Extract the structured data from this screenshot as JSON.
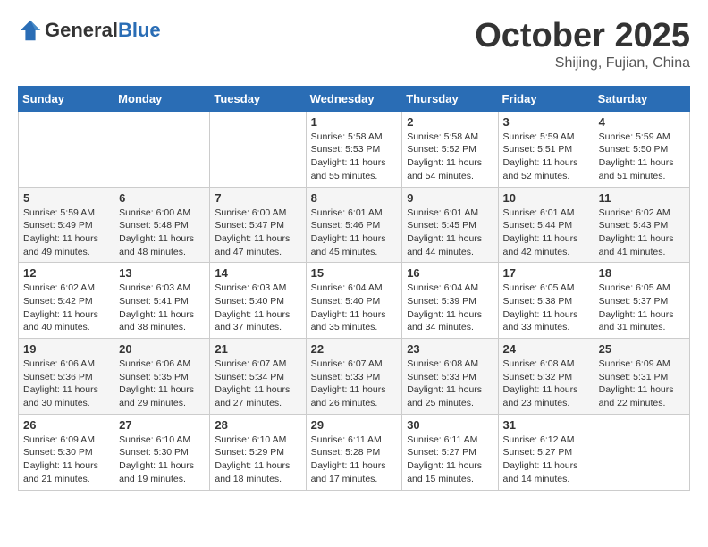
{
  "header": {
    "logo_general": "General",
    "logo_blue": "Blue",
    "month": "October 2025",
    "location": "Shijing, Fujian, China"
  },
  "weekdays": [
    "Sunday",
    "Monday",
    "Tuesday",
    "Wednesday",
    "Thursday",
    "Friday",
    "Saturday"
  ],
  "weeks": [
    [
      {
        "day": "",
        "info": ""
      },
      {
        "day": "",
        "info": ""
      },
      {
        "day": "",
        "info": ""
      },
      {
        "day": "1",
        "info": "Sunrise: 5:58 AM\nSunset: 5:53 PM\nDaylight: 11 hours and 55 minutes."
      },
      {
        "day": "2",
        "info": "Sunrise: 5:58 AM\nSunset: 5:52 PM\nDaylight: 11 hours and 54 minutes."
      },
      {
        "day": "3",
        "info": "Sunrise: 5:59 AM\nSunset: 5:51 PM\nDaylight: 11 hours and 52 minutes."
      },
      {
        "day": "4",
        "info": "Sunrise: 5:59 AM\nSunset: 5:50 PM\nDaylight: 11 hours and 51 minutes."
      }
    ],
    [
      {
        "day": "5",
        "info": "Sunrise: 5:59 AM\nSunset: 5:49 PM\nDaylight: 11 hours and 49 minutes."
      },
      {
        "day": "6",
        "info": "Sunrise: 6:00 AM\nSunset: 5:48 PM\nDaylight: 11 hours and 48 minutes."
      },
      {
        "day": "7",
        "info": "Sunrise: 6:00 AM\nSunset: 5:47 PM\nDaylight: 11 hours and 47 minutes."
      },
      {
        "day": "8",
        "info": "Sunrise: 6:01 AM\nSunset: 5:46 PM\nDaylight: 11 hours and 45 minutes."
      },
      {
        "day": "9",
        "info": "Sunrise: 6:01 AM\nSunset: 5:45 PM\nDaylight: 11 hours and 44 minutes."
      },
      {
        "day": "10",
        "info": "Sunrise: 6:01 AM\nSunset: 5:44 PM\nDaylight: 11 hours and 42 minutes."
      },
      {
        "day": "11",
        "info": "Sunrise: 6:02 AM\nSunset: 5:43 PM\nDaylight: 11 hours and 41 minutes."
      }
    ],
    [
      {
        "day": "12",
        "info": "Sunrise: 6:02 AM\nSunset: 5:42 PM\nDaylight: 11 hours and 40 minutes."
      },
      {
        "day": "13",
        "info": "Sunrise: 6:03 AM\nSunset: 5:41 PM\nDaylight: 11 hours and 38 minutes."
      },
      {
        "day": "14",
        "info": "Sunrise: 6:03 AM\nSunset: 5:40 PM\nDaylight: 11 hours and 37 minutes."
      },
      {
        "day": "15",
        "info": "Sunrise: 6:04 AM\nSunset: 5:40 PM\nDaylight: 11 hours and 35 minutes."
      },
      {
        "day": "16",
        "info": "Sunrise: 6:04 AM\nSunset: 5:39 PM\nDaylight: 11 hours and 34 minutes."
      },
      {
        "day": "17",
        "info": "Sunrise: 6:05 AM\nSunset: 5:38 PM\nDaylight: 11 hours and 33 minutes."
      },
      {
        "day": "18",
        "info": "Sunrise: 6:05 AM\nSunset: 5:37 PM\nDaylight: 11 hours and 31 minutes."
      }
    ],
    [
      {
        "day": "19",
        "info": "Sunrise: 6:06 AM\nSunset: 5:36 PM\nDaylight: 11 hours and 30 minutes."
      },
      {
        "day": "20",
        "info": "Sunrise: 6:06 AM\nSunset: 5:35 PM\nDaylight: 11 hours and 29 minutes."
      },
      {
        "day": "21",
        "info": "Sunrise: 6:07 AM\nSunset: 5:34 PM\nDaylight: 11 hours and 27 minutes."
      },
      {
        "day": "22",
        "info": "Sunrise: 6:07 AM\nSunset: 5:33 PM\nDaylight: 11 hours and 26 minutes."
      },
      {
        "day": "23",
        "info": "Sunrise: 6:08 AM\nSunset: 5:33 PM\nDaylight: 11 hours and 25 minutes."
      },
      {
        "day": "24",
        "info": "Sunrise: 6:08 AM\nSunset: 5:32 PM\nDaylight: 11 hours and 23 minutes."
      },
      {
        "day": "25",
        "info": "Sunrise: 6:09 AM\nSunset: 5:31 PM\nDaylight: 11 hours and 22 minutes."
      }
    ],
    [
      {
        "day": "26",
        "info": "Sunrise: 6:09 AM\nSunset: 5:30 PM\nDaylight: 11 hours and 21 minutes."
      },
      {
        "day": "27",
        "info": "Sunrise: 6:10 AM\nSunset: 5:30 PM\nDaylight: 11 hours and 19 minutes."
      },
      {
        "day": "28",
        "info": "Sunrise: 6:10 AM\nSunset: 5:29 PM\nDaylight: 11 hours and 18 minutes."
      },
      {
        "day": "29",
        "info": "Sunrise: 6:11 AM\nSunset: 5:28 PM\nDaylight: 11 hours and 17 minutes."
      },
      {
        "day": "30",
        "info": "Sunrise: 6:11 AM\nSunset: 5:27 PM\nDaylight: 11 hours and 15 minutes."
      },
      {
        "day": "31",
        "info": "Sunrise: 6:12 AM\nSunset: 5:27 PM\nDaylight: 11 hours and 14 minutes."
      },
      {
        "day": "",
        "info": ""
      }
    ]
  ]
}
